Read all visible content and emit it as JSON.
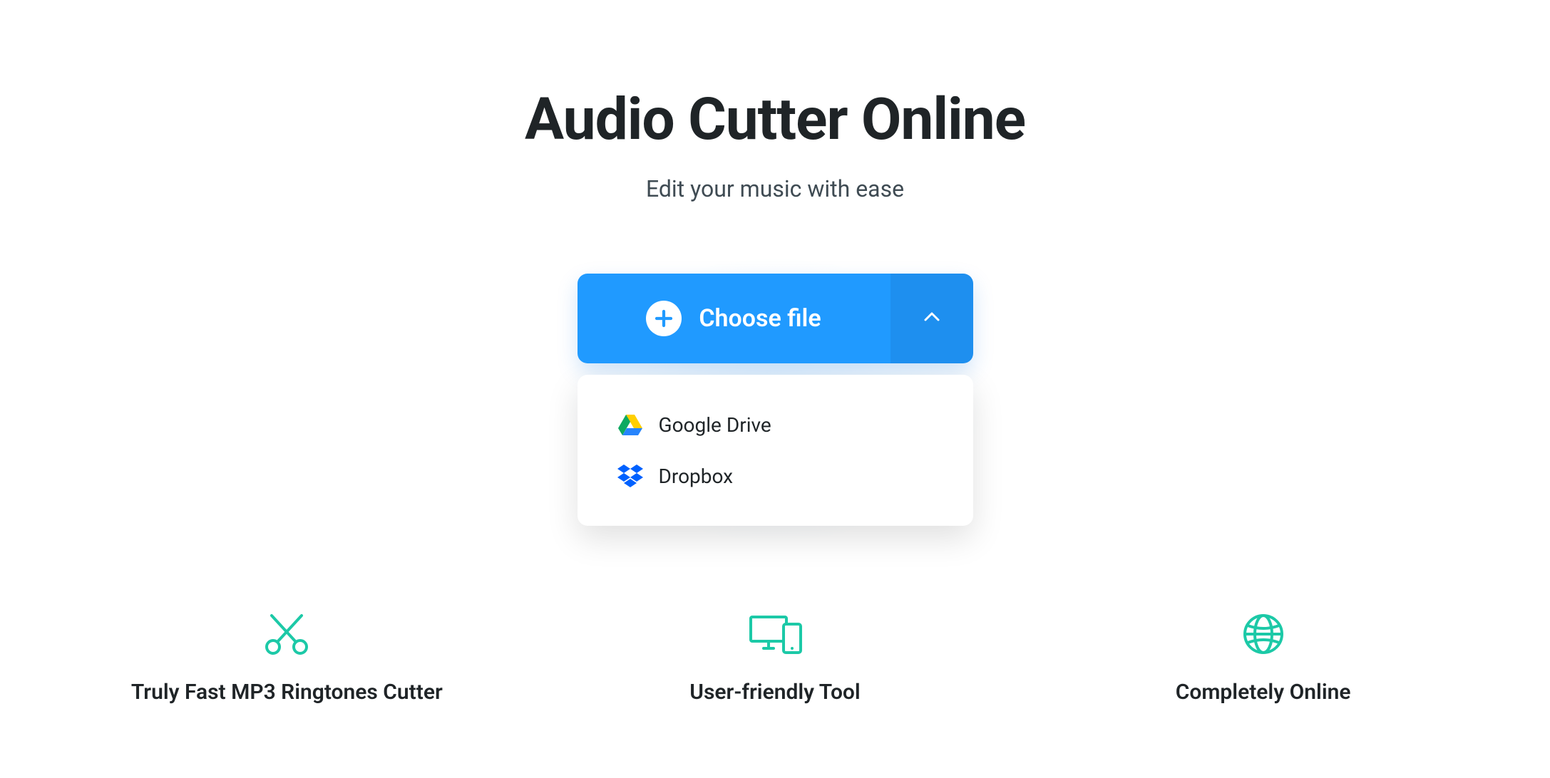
{
  "hero": {
    "title": "Audio Cutter Online",
    "subtitle": "Edit your music with ease"
  },
  "uploader": {
    "choose_label": "Choose file",
    "dropdown": [
      {
        "label": "Google Drive"
      },
      {
        "label": "Dropbox"
      }
    ]
  },
  "features": [
    {
      "title": "Truly Fast MP3 Ringtones Cutter"
    },
    {
      "title": "User-friendly Tool"
    },
    {
      "title": "Completely Online"
    }
  ],
  "colors": {
    "primary": "#209aff",
    "primary_dark": "#1e8fef",
    "accent_green": "#1cc9a7",
    "dropbox_blue": "#0061ff"
  }
}
